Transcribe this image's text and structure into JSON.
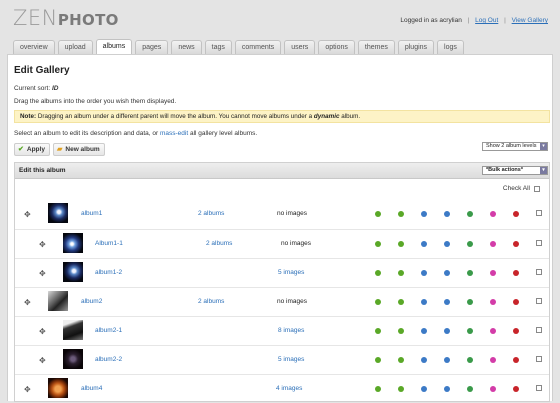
{
  "app": {
    "logo_zen": "ZEN",
    "logo_photo": "PHOTO"
  },
  "userbar": {
    "logged_in": "Logged in as acrylian",
    "logout": "Log Out",
    "view_gallery": "View Gallery"
  },
  "tabs": [
    "overview",
    "upload",
    "albums",
    "pages",
    "news",
    "tags",
    "comments",
    "users",
    "options",
    "themes",
    "plugins",
    "logs"
  ],
  "active_tab": "albums",
  "page": {
    "title": "Edit Gallery",
    "current_sort_label": "Current sort:",
    "current_sort_value": "ID",
    "drag_hint": "Drag the albums into the order you wish them displayed.",
    "note_label": "Note:",
    "note_text": "Dragging an album under a different parent will move the album. You cannot move albums under a",
    "note_dynamic": "dynamic",
    "note_end": "album.",
    "select_prefix": "Select an album to edit its description and data, or",
    "select_link": "mass-edit",
    "select_suffix": "all gallery level albums."
  },
  "buttons": {
    "apply": "Apply",
    "new_album": "New album"
  },
  "levels_select": "Show 2 album levels",
  "table": {
    "heading": "Edit this album",
    "bulk_select": "*Bulk actions*",
    "check_all": "Check All"
  },
  "status_colors": [
    "#5aa827",
    "#5aa827",
    "#3c7ac6",
    "#3c7ac6",
    "#3a9a4a",
    "#d33ca8",
    "#c8242a"
  ],
  "albums": [
    {
      "name": "album1",
      "subs": "2 albums",
      "images": "no images"
    },
    {
      "name": "Album1-1",
      "subs": "2 albums",
      "images": "no images"
    },
    {
      "name": "album1-2",
      "subs": "",
      "images": "5 images"
    },
    {
      "name": "album2",
      "subs": "2 albums",
      "images": "no images"
    },
    {
      "name": "album2-1",
      "subs": "",
      "images": "8 images"
    },
    {
      "name": "album2-2",
      "subs": "",
      "images": "5 images"
    },
    {
      "name": "album4",
      "subs": "",
      "images": "4 images"
    }
  ]
}
